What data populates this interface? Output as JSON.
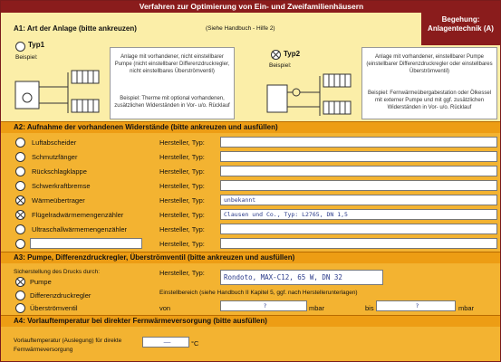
{
  "title": "Verfahren zur Optimierung von Ein- und Zweifamilienhäusern",
  "badge": "Begehung: Anlagentechnik (A)",
  "a1": {
    "heading": "A1: Art der Anlage (bitte ankreuzen)",
    "handbook": "(Siehe Handbuch - Hilfe 2)",
    "typ1": {
      "label": "Typ1",
      "beispiel": "Beispiel:",
      "desc": "Anlage mit vorhandener, nicht einstellbarer Pumpe (nicht einstellbarer Differenzdruckregler, nicht einstellbares Überströmventil)",
      "example": "Beispiel: Therme mit optional vorhandenen, zusätzlichen Widerständen in Vor- u/o. Rücklauf"
    },
    "typ2": {
      "label": "Typ2",
      "beispiel": "Beispiel:",
      "desc": "Anlage mit vorhandener, einstellbarer Pumpe (einstellbarer Differenzdruckregler oder einstellbares Überströmventil)",
      "example": "Beispiel: Fernwärmeübergabestation oder Ölkessel mit externer Pumpe und mit ggf. zusätzlichen Widerständen in Vor- u/o. Rücklauf"
    }
  },
  "a2": {
    "heading": "A2: Aufnahme der vorhandenen Widerstände (bitte ankreuzen und ausfüllen)",
    "hersteller_label": "Hersteller, Typ:",
    "rows": [
      {
        "label": "Luftabscheider",
        "checked": false,
        "value": ""
      },
      {
        "label": "Schmutzfänger",
        "checked": false,
        "value": ""
      },
      {
        "label": "Rückschlagklappe",
        "checked": false,
        "value": ""
      },
      {
        "label": "Schwerkraftbremse",
        "checked": false,
        "value": ""
      },
      {
        "label": "Wärmeübertrager",
        "checked": true,
        "value": "unbekannt"
      },
      {
        "label": "Flügelradwärmemengenzähler",
        "checked": true,
        "value": "Clausen und Co., Typ: L2765, DN 1,5"
      },
      {
        "label": "Ultraschallwärmemengenzähler",
        "checked": false,
        "value": ""
      },
      {
        "label": "",
        "checked": false,
        "value": ""
      }
    ]
  },
  "a3": {
    "heading": "A3: Pumpe, Differenzdruckregler, Überströmventil (bitte ankreuzen und ausfüllen)",
    "sicherstellung": "Sicherstellung des Drucks durch:",
    "options": [
      {
        "label": "Pumpe",
        "checked": true
      },
      {
        "label": "Differenzdruckregler",
        "checked": false
      },
      {
        "label": "Überströmventil",
        "checked": false
      }
    ],
    "hersteller_label": "Hersteller, Typ:",
    "hersteller_value": "Rondoto, MAX-C12, 65 W, DN 32",
    "einstell": "Einstellbereich (siehe Handbuch II Kapitel 5, ggf. nach Herstellerunterlagen)",
    "von": "von",
    "von_value": "?",
    "mbar1": "mbar",
    "bis": "bis",
    "bis_value": "?",
    "mbar2": "mbar"
  },
  "a4": {
    "heading": "A4: Vorlauftemperatur bei direkter Fernwärmeversorgung (bitte ausfüllen)",
    "label": "Vorlauftemperatur (Auslegung) für direkte Fernwärmeversorgung",
    "value": "——",
    "unit": "°C"
  },
  "colors": {
    "title_bg": "#8a1c1c",
    "section1_bg": "#fbeea8",
    "section_bg": "#f3b331",
    "header_bar": "#ed9d14",
    "handwriting": "#2a3a8a"
  }
}
